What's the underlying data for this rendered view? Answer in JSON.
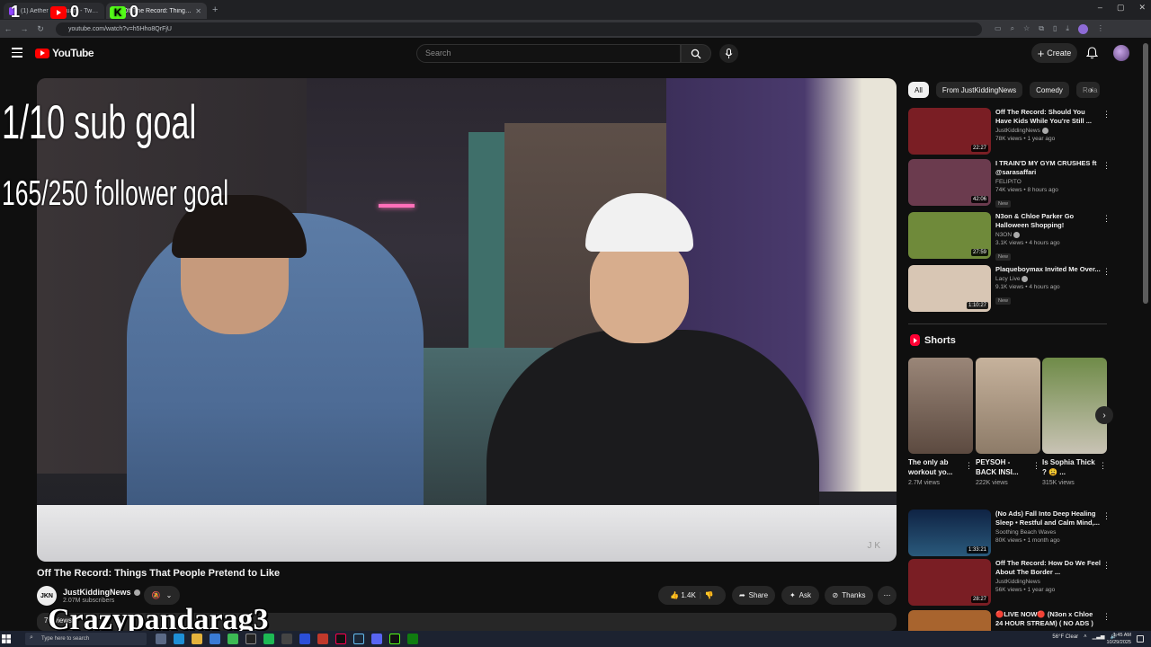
{
  "browser": {
    "tabs": [
      {
        "label": "(1) Aether Sanctuary - Twitch",
        "icon_color": "#9146ff",
        "active": false
      },
      {
        "label": "Off The Record: Things That People Pretend to Like",
        "icon_color": "#ff0000",
        "active": true
      }
    ],
    "new_tab_label": "+",
    "url": "youtube.com/watch?v=h5Hho8QrFjU",
    "window_controls": [
      "–",
      "▢",
      "✕"
    ]
  },
  "overlay": {
    "youtube_count": "1",
    "youtube_count2": "0",
    "kick_count": "0",
    "kick_letter": "K",
    "sub_goal": "1/10 sub goal",
    "follower_goal": "165/250 follower goal",
    "streamer_name": "Crazypandarag3"
  },
  "youtube": {
    "logo_text": "YouTube",
    "search_placeholder": "Search",
    "create_label": "Create",
    "video": {
      "title": "Off The Record: Things That People Pretend to Like",
      "watermark": "J K",
      "channel": "JustKiddingNews",
      "channel_avatar_text": "JKN",
      "subscribers": "2.07M subscribers",
      "likes": "1.4K",
      "share_label": "Share",
      "ask_label": "Ask",
      "thanks_label": "Thanks",
      "views_partial": "79 views"
    },
    "chips": [
      "All",
      "From JustKiddingNews",
      "Comedy",
      "Rela"
    ],
    "recommendations": [
      {
        "title": "Off The Record: Should You Have Kids While You're Still ...",
        "channel": "JustKiddingNews",
        "verified": true,
        "meta": "78K views • 1 year ago",
        "duration": "22:27",
        "badge": "",
        "thumb_color": "#7a1e24"
      },
      {
        "title": "I TRAIN'D MY GYM CRUSHES ft @sarasaffari",
        "channel": "FELIPITO",
        "verified": false,
        "meta": "74K views • 8 hours ago",
        "duration": "42:06",
        "badge": "New",
        "thumb_color": "#6b3b4e"
      },
      {
        "title": "N3on & Chloe Parker Go Halloween Shopping!",
        "channel": "N3ON",
        "verified": true,
        "meta": "3.1K views • 4 hours ago",
        "duration": "27:59",
        "badge": "New",
        "thumb_color": "#6f8a3a"
      },
      {
        "title": "Plaqueboymax Invited Me Over...",
        "channel": "Lacy Live",
        "verified": true,
        "meta": "9.1K views • 4 hours ago",
        "duration": "1:10:27",
        "badge": "New",
        "thumb_color": "#d8c6b4"
      },
      {
        "title": "(No Ads) Fall Into Deep Healing Sleep • Restful and Calm Mind,...",
        "channel": "Soothing Beach Waves",
        "verified": false,
        "meta": "80K views • 1 month ago",
        "duration": "1:33:21",
        "badge": "",
        "thumb_color": "#1c3b5c"
      },
      {
        "title": "Off The Record: How Do We Feel About The Border ...",
        "channel": "JustKiddingNews",
        "verified": false,
        "meta": "56K views • 1 year ago",
        "duration": "28:27",
        "badge": "",
        "thumb_color": "#7a1e24"
      },
      {
        "title": "🔴LIVE NOW🔴 (N3on x Chloe 24 HOUR STREAM) ( NO ADS )",
        "channel": "",
        "verified": false,
        "meta": "",
        "duration": "",
        "badge": "",
        "thumb_color": "#a8642e"
      }
    ],
    "shorts_heading": "Shorts",
    "shorts": [
      {
        "title": "The only ab workout yo...",
        "views": "2.7M views",
        "thumb_color": "#8a7a70"
      },
      {
        "title": "PEYSOH - BACK INSI...",
        "views": "222K views",
        "thumb_color": "#b8a48e"
      },
      {
        "title": "Is Sophia Thick ? 😩 ...",
        "views": "315K views",
        "thumb_color": "#5f7b3c"
      }
    ]
  },
  "taskbar": {
    "search_placeholder": "Type here to search",
    "weather": "56°F  Clear",
    "time": "1:45 AM",
    "date": "10/29/2025"
  }
}
